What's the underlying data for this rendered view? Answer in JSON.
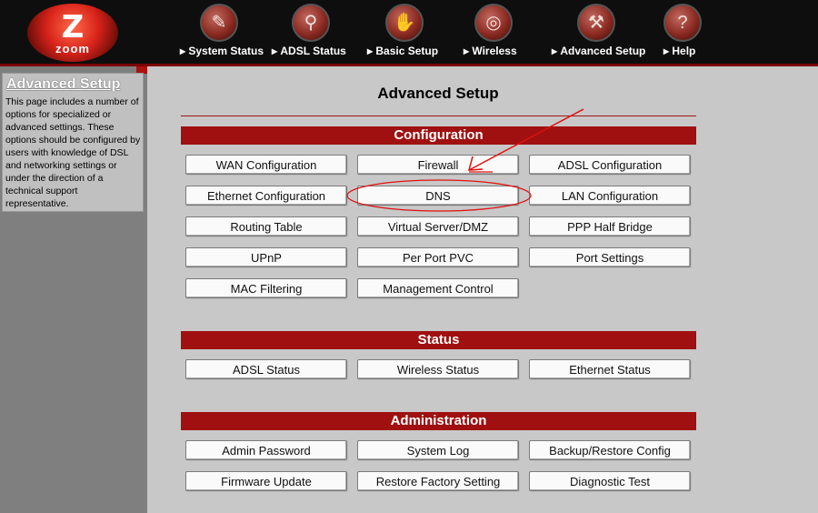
{
  "logo": {
    "mark": "Z",
    "text": "zoom"
  },
  "nav": [
    {
      "label": "System Status",
      "icon": "system-status-icon",
      "glyph": "✎"
    },
    {
      "label": "ADSL Status",
      "icon": "magnifier-icon",
      "glyph": "⚲"
    },
    {
      "label": "Basic Setup",
      "icon": "hand-icon",
      "glyph": "✋"
    },
    {
      "label": "Wireless",
      "icon": "wireless-icon",
      "glyph": "◎"
    },
    {
      "label": "Advanced Setup",
      "icon": "wrench-icon",
      "glyph": "⚒"
    },
    {
      "label": "Help",
      "icon": "help-icon",
      "glyph": "?"
    }
  ],
  "sidebar": {
    "title": "Advanced Setup",
    "description": "This page includes a number of options for specialized or advanced settings. These options should be configured by users with knowledge of DSL and networking settings or under the direction of a technical support representative."
  },
  "main": {
    "title": "Advanced Setup",
    "sections": [
      {
        "name": "Configuration",
        "buttons": [
          "WAN Configuration",
          "Firewall",
          "ADSL Configuration",
          "Ethernet Configuration",
          "DNS",
          "LAN Configuration",
          "Routing Table",
          "Virtual Server/DMZ",
          "PPP Half Bridge",
          "UPnP",
          "Per Port PVC",
          "Port Settings",
          "MAC Filtering",
          "Management Control"
        ]
      },
      {
        "name": "Status",
        "buttons": [
          "ADSL Status",
          "Wireless Status",
          "Ethernet Status"
        ]
      },
      {
        "name": "Administration",
        "buttons": [
          "Admin Password",
          "System Log",
          "Backup/Restore Config",
          "Firmware Update",
          "Restore Factory Setting",
          "Diagnostic Test"
        ]
      }
    ]
  },
  "colors": {
    "accent": "#a01010",
    "annotation": "#e01010",
    "header": "#0e0e0e"
  }
}
